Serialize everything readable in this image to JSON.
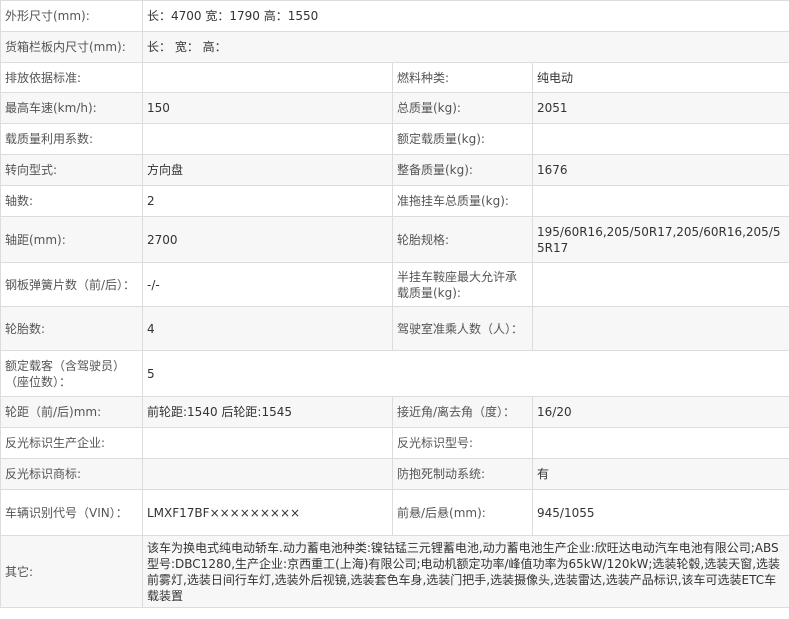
{
  "rows": [
    {
      "cells": [
        {
          "label": "外形尺寸(mm):",
          "value": "长：4700 宽：1790 高：1550",
          "span": 3
        }
      ]
    },
    {
      "cells": [
        {
          "label": "货箱栏板内尺寸(mm):",
          "value": "长：  宽：  高：",
          "span": 3
        }
      ]
    },
    {
      "cells": [
        {
          "label": "排放依据标准:",
          "value": ""
        },
        {
          "label": "燃料种类:",
          "value": "纯电动"
        }
      ]
    },
    {
      "cells": [
        {
          "label": "最高车速(km/h):",
          "value": "150"
        },
        {
          "label": "总质量(kg):",
          "value": "2051"
        }
      ]
    },
    {
      "cells": [
        {
          "label": "载质量利用系数:",
          "value": ""
        },
        {
          "label": "额定载质量(kg):",
          "value": ""
        }
      ]
    },
    {
      "cells": [
        {
          "label": "转向型式:",
          "value": "方向盘"
        },
        {
          "label": "整备质量(kg):",
          "value": "1676"
        }
      ]
    },
    {
      "cells": [
        {
          "label": "轴数:",
          "value": "2"
        },
        {
          "label": "准拖挂车总质量(kg):",
          "value": ""
        }
      ]
    },
    {
      "cells": [
        {
          "label": "轴距(mm):",
          "value": "2700"
        },
        {
          "label": "轮胎规格:",
          "value": "195/60R16,205/50R17,205/60R16,205/55R17"
        }
      ]
    },
    {
      "cells": [
        {
          "label": "钢板弹簧片数（前/后）：",
          "value": "-/-"
        },
        {
          "label": "半挂车鞍座最大允许承载质量(kg):",
          "value": ""
        }
      ]
    },
    {
      "cells": [
        {
          "label": "轮胎数:",
          "value": "4"
        },
        {
          "label": "驾驶室准乘人数（人）：",
          "value": ""
        }
      ]
    },
    {
      "cells": [
        {
          "label": "额定载客（含驾驶员）（座位数）：",
          "value": "5",
          "span": 3
        }
      ]
    },
    {
      "cells": [
        {
          "label": "轮距（前/后)mm:",
          "value": "前轮距:1540 后轮距:1545"
        },
        {
          "label": "接近角/离去角（度）：",
          "value": "16/20"
        }
      ]
    },
    {
      "cells": [
        {
          "label": "反光标识生产企业:",
          "value": ""
        },
        {
          "label": "反光标识型号:",
          "value": ""
        }
      ]
    },
    {
      "cells": [
        {
          "label": "反光标识商标:",
          "value": ""
        },
        {
          "label": "防抱死制动系统:",
          "value": "有"
        }
      ]
    },
    {
      "cells": [
        {
          "label": "车辆识别代号（VIN）：",
          "value": "LMXF17BF×××××××××"
        },
        {
          "label": "前悬/后悬(mm):",
          "value": "945/1055"
        }
      ]
    },
    {
      "cells": [
        {
          "label": "其它:",
          "value": "该车为换电式纯电动轿车.动力蓄电池种类:镍钴锰三元锂蓄电池,动力蓄电池生产企业:欣旺达电动汽车电池有限公司;ABS型号:DBC1280,生产企业:京西重工(上海)有限公司;电动机额定功率/峰值功率为65kW/120kW;选装轮毂,选装天窗,选装前雾灯,选装日间行车灯,选装外后视镜,选装套色车身,选装门把手,选装摄像头,选装雷达,选装产品标识,该车可选装ETC车载装置",
          "span": 3
        }
      ]
    }
  ]
}
